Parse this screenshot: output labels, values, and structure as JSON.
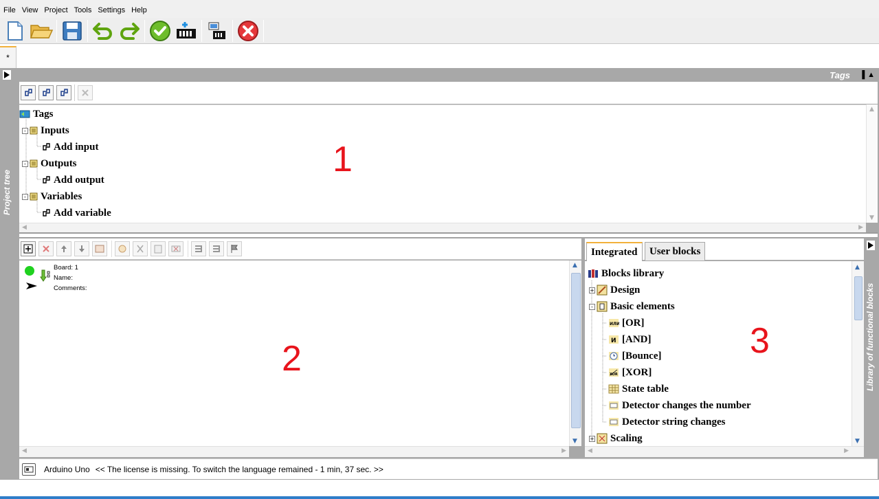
{
  "menu": [
    "File",
    "View",
    "Project",
    "Tools",
    "Settings",
    "Help"
  ],
  "toolbar": {
    "buttons": [
      "new-file-icon",
      "open-folder-icon",
      "save-icon",
      "undo-icon",
      "redo-icon",
      "verify-check-icon",
      "compile-board-icon",
      "upload-board-icon",
      "stop-icon"
    ]
  },
  "doc_tab": "*",
  "left_strip_label": "Project tree",
  "right_strip_label": "Library of functional blocks",
  "tags_panel": {
    "title": "Tags",
    "tree": [
      {
        "label": "Tags",
        "level": 0,
        "icon": "tags-root-icon"
      },
      {
        "label": "Inputs",
        "level": 1,
        "icon": "folder-icon",
        "expander": "-"
      },
      {
        "label": "Add input",
        "level": 2,
        "icon": "add-tag-icon"
      },
      {
        "label": "Outputs",
        "level": 1,
        "icon": "folder-icon",
        "expander": "-"
      },
      {
        "label": "Add output",
        "level": 2,
        "icon": "add-tag-icon"
      },
      {
        "label": "Variables",
        "level": 1,
        "icon": "folder-icon",
        "expander": "-"
      },
      {
        "label": "Add variable",
        "level": 2,
        "icon": "add-tag-icon"
      }
    ]
  },
  "workspace": {
    "board_label": "Board: 1",
    "name_label": "Name:",
    "comments_label": "Comments:",
    "status_color": "#1fd11f"
  },
  "library": {
    "tabs": [
      "Integrated",
      "User blocks"
    ],
    "active_tab": "Integrated",
    "tree": [
      {
        "label": "Blocks library",
        "level": 0
      },
      {
        "label": "Design",
        "level": 1,
        "expander": "+"
      },
      {
        "label": "Basic elements",
        "level": 1,
        "expander": "-"
      },
      {
        "label": "[OR]",
        "level": 2
      },
      {
        "label": "[AND]",
        "level": 2
      },
      {
        "label": "[Bounce]",
        "level": 2
      },
      {
        "label": "[XOR]",
        "level": 2
      },
      {
        "label": "State table",
        "level": 2
      },
      {
        "label": "Detector changes the number",
        "level": 2
      },
      {
        "label": "Detector string changes",
        "level": 2
      },
      {
        "label": "Scaling",
        "level": 1,
        "expander": "+"
      }
    ]
  },
  "annotations": [
    "1",
    "2",
    "3"
  ],
  "annotation_color": "#e8141c",
  "status": {
    "board": "Arduino Uno",
    "message": "<< The license is missing. To switch the language remained - 1 min, 37 sec.  >>"
  }
}
